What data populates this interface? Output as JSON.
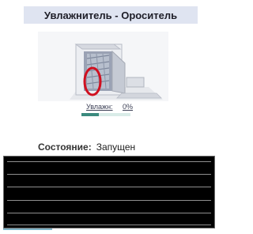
{
  "header": {
    "title": "Увлажнитель - Ороситель"
  },
  "device": {
    "image": "humidifier-sprinkler-icon",
    "highlight_color": "#d01020",
    "humidity_label": "Увлажн:",
    "humidity_value": "0%",
    "humidity_fraction": 0.35
  },
  "status": {
    "label": "Состояние:",
    "value": "Запущен"
  },
  "log": {
    "background": "#000000",
    "line_count": 5
  }
}
